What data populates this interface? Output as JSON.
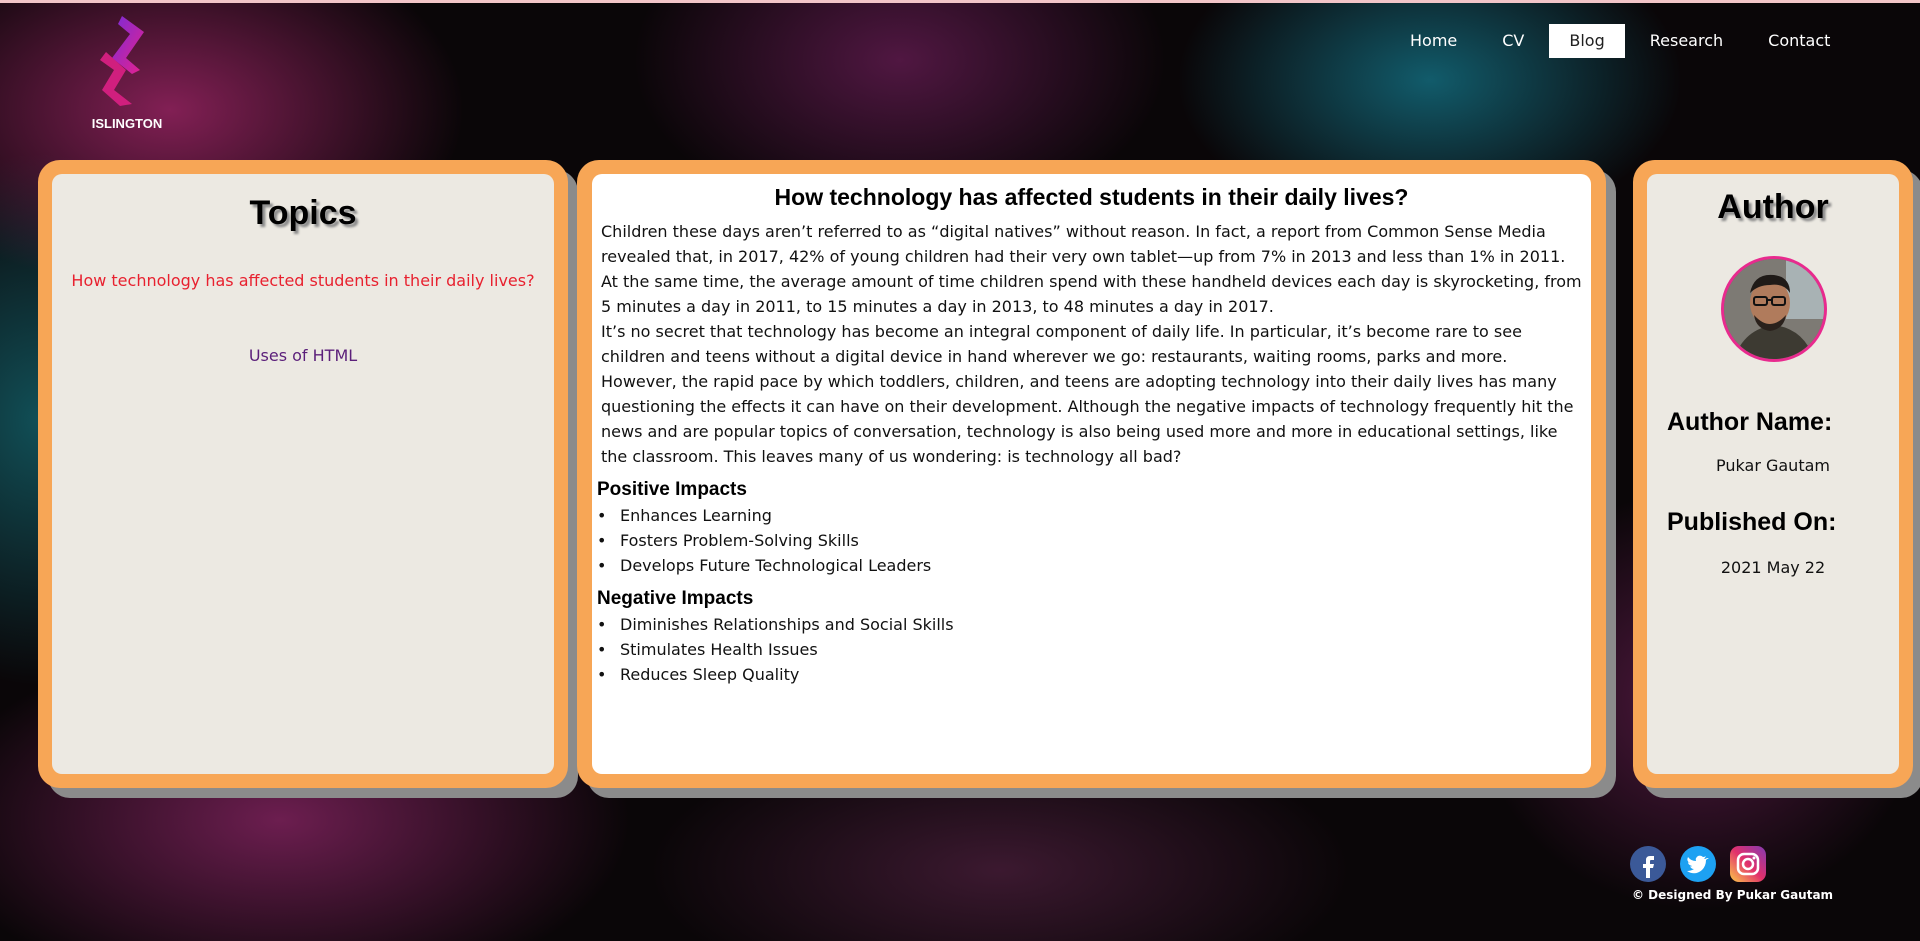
{
  "brand": {
    "logo_text": "ISLINGTON"
  },
  "nav": {
    "items": [
      {
        "label": "Home",
        "active": false
      },
      {
        "label": "CV",
        "active": false
      },
      {
        "label": "Blog",
        "active": true
      },
      {
        "label": "Research",
        "active": false
      },
      {
        "label": "Contact",
        "active": false
      }
    ]
  },
  "topics": {
    "title": "Topics",
    "items": [
      "How technology has affected students in their daily lives?",
      "Uses of HTML"
    ]
  },
  "article": {
    "title": "How technology has affected students in their daily lives?",
    "paragraphs": [
      "Children these days aren’t referred to as “digital natives” without reason. In fact, a report from Common Sense Media revealed that, in 2017, 42% of young children had their very own tablet—up from 7% in 2013 and less than 1% in 2011. At the same time, the average amount of time children spend with these handheld devices each day is skyrocketing, from 5 minutes a day in 2011, to 15 minutes a day in 2013, to 48 minutes a day in 2017.",
      "It’s no secret that technology has become an integral component of daily life. In particular, it’s become rare to see children and teens without a digital device in hand wherever we go: restaurants, waiting rooms, parks and more.",
      "However, the rapid pace by which toddlers, children, and teens are adopting technology into their daily lives has many questioning the effects it can have on their development. Although the negative impacts of technology frequently hit the news and are popular topics of conversation, technology is also being used more and more in educational settings, like the classroom. This leaves many of us wondering: is technology all bad?"
    ],
    "positive_heading": "Positive Impacts",
    "positive": [
      "Enhances Learning",
      "Fosters Problem-Solving Skills",
      "Develops Future Technological Leaders"
    ],
    "negative_heading": "Negative Impacts",
    "negative": [
      "Diminishes Relationships and Social Skills",
      "Stimulates Health Issues",
      "Reduces Sleep Quality"
    ]
  },
  "author": {
    "title": "Author",
    "name_label": "Author Name:",
    "name": "Pukar Gautam",
    "published_label": "Published On:",
    "published": "2021 May 22"
  },
  "footer": {
    "social": [
      "facebook-icon",
      "twitter-icon",
      "instagram-icon"
    ],
    "credit": "© Designed By Pukar Gautam"
  },
  "colors": {
    "panel_border": "#f7a656",
    "panel_fill": "#ece9e2",
    "topic_active": "#e8212f",
    "topic_link": "#5b1f7a",
    "avatar_ring": "#e82a8e"
  }
}
